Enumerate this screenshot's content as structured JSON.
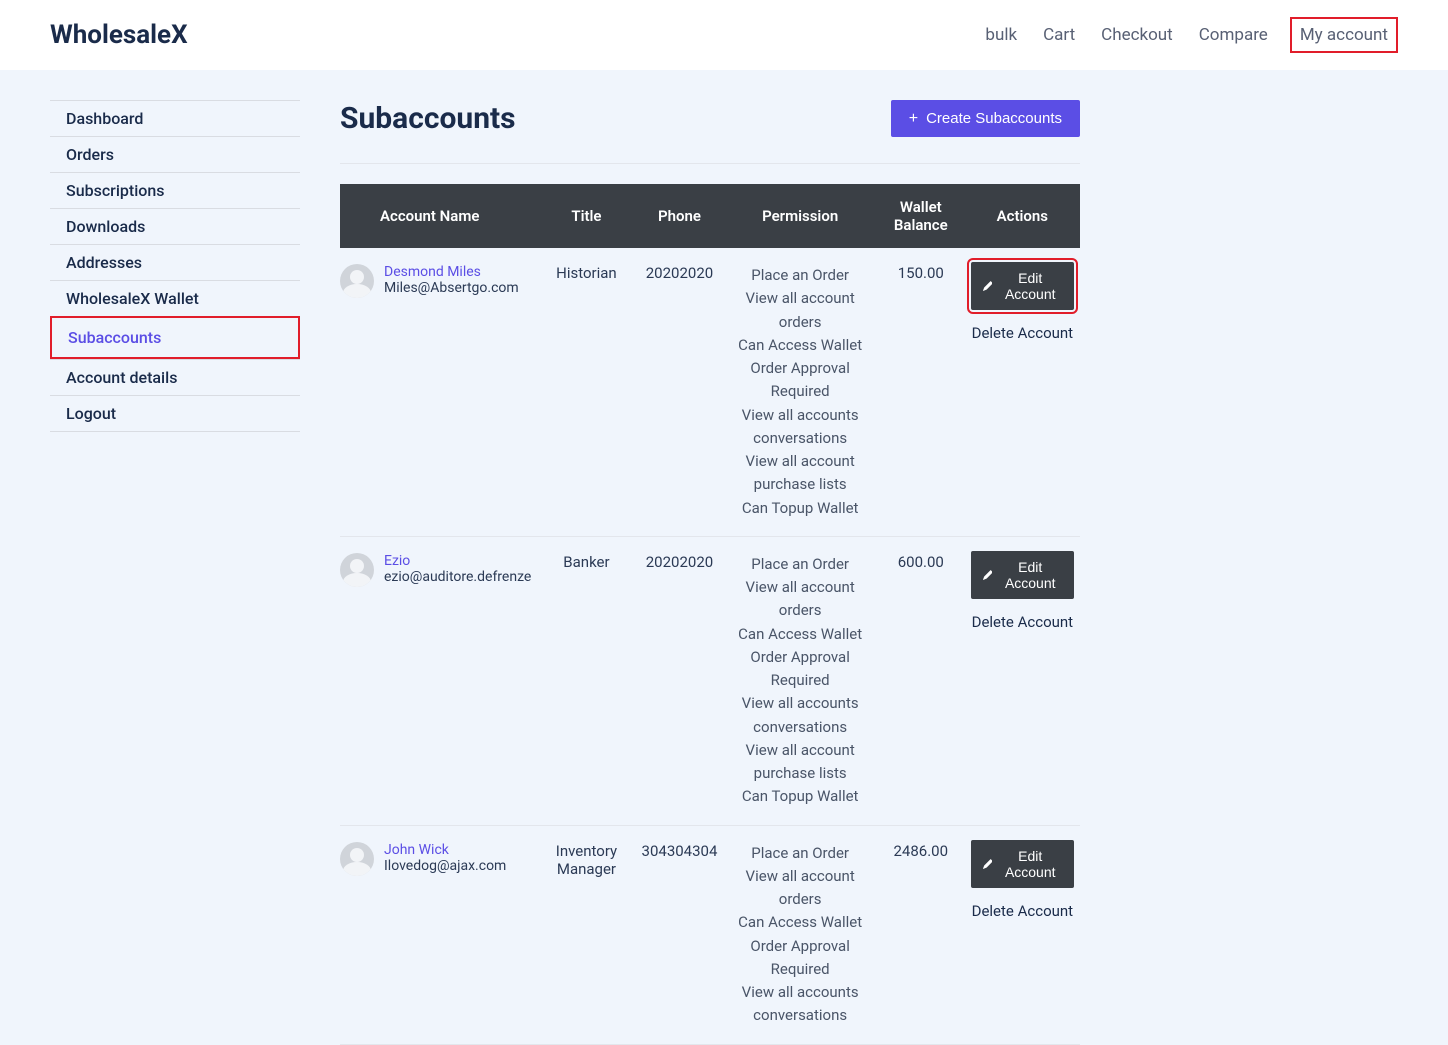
{
  "brand": "WholesaleX",
  "topnav": {
    "bulk": "bulk",
    "cart": "Cart",
    "checkout": "Checkout",
    "compare": "Compare",
    "myaccount": "My account"
  },
  "sidebar": {
    "dashboard": "Dashboard",
    "orders": "Orders",
    "subscriptions": "Subscriptions",
    "downloads": "Downloads",
    "addresses": "Addresses",
    "wallet": "WholesaleX Wallet",
    "subaccounts": "Subaccounts",
    "account_details": "Account details",
    "logout": "Logout"
  },
  "page": {
    "title": "Subaccounts",
    "create_btn": "Create Subaccounts"
  },
  "table": {
    "headers": {
      "account_name": "Account Name",
      "title": "Title",
      "phone": "Phone",
      "permission": "Permission",
      "wallet_balance": "Wallet Balance",
      "actions": "Actions"
    }
  },
  "permissions_list": [
    "Place an Order",
    "View all account orders",
    "Can Access Wallet",
    "Order Approval Required",
    "View all accounts conversations",
    "View all account purchase lists",
    "Can Topup Wallet"
  ],
  "permissions_short": [
    "Place an Order",
    "View all account orders",
    "Can Access Wallet",
    "Order Approval Required",
    "View all accounts conversations"
  ],
  "rows": [
    {
      "name": "Desmond Miles",
      "email": "Miles@Absertgo.com",
      "title": "Historian",
      "phone": "20202020",
      "balance": "150.00",
      "edit_highlight": true
    },
    {
      "name": "Ezio",
      "email": "ezio@auditore.defrenze",
      "title": "Banker",
      "phone": "20202020",
      "balance": "600.00",
      "edit_highlight": false
    },
    {
      "name": "John Wick",
      "email": "Ilovedog@ajax.com",
      "title": "Inventory Manager",
      "phone": "304304304",
      "balance": "2486.00",
      "edit_highlight": false
    }
  ],
  "actions": {
    "edit": "Edit Account",
    "delete": "Delete Account"
  }
}
